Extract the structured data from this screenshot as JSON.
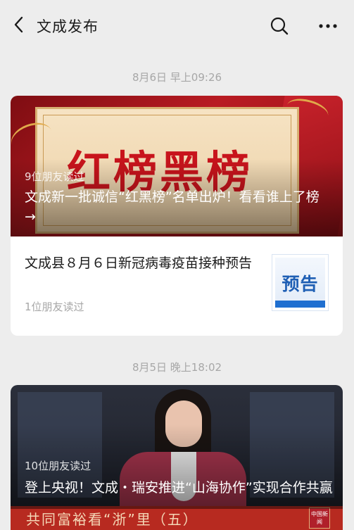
{
  "header": {
    "title": "文成发布",
    "back_icon": "chevron-left-icon",
    "search_icon": "search-icon",
    "more_icon": "more-dots-icon"
  },
  "groups": [
    {
      "date": "8月6日 早上09:26",
      "hero": {
        "image_text": "红榜黑榜",
        "friends_read": "9位朋友读过",
        "title": "文成新一批诚信“红黑榜”名单出炉！看看谁上了榜 →"
      },
      "items": [
        {
          "title": "文成县８月６日新冠病毒疫苗接种预告",
          "friends_read": "1位朋友读过",
          "thumb_label": "预告"
        }
      ]
    },
    {
      "date": "8月5日 晚上18:02",
      "hero": {
        "friends_read": "10位朋友读过",
        "title": "登上央视！文成・瑞安推进“山海协作”实现合作共赢",
        "banner_text": "共同富裕看“浙”里（五）",
        "logo_text": "中国新闻"
      }
    }
  ],
  "colors": {
    "background": "#ededed",
    "card": "#ffffff",
    "meta_text": "#a7a7a7",
    "primary_text": "#1a1a1a"
  }
}
